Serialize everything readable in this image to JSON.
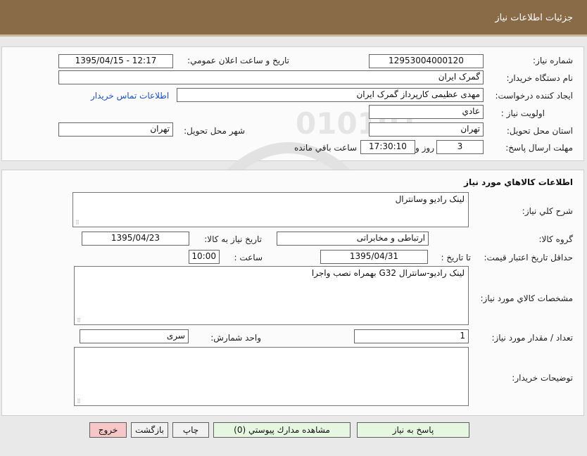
{
  "header": {
    "title": "جزئیات اطلاعات نیاز"
  },
  "general": {
    "need_number_label": "شماره نیاز:",
    "need_number": "12953004000120",
    "announce_label": "تاريخ و ساعت اعلان عمومي:",
    "announce_value": "1395/04/15 - 12:17",
    "buyer_org_label": "نام دستگاه خريدار:",
    "buyer_org": "گمرک ايران",
    "creator_label": "ايجاد كننده درخواست:",
    "creator": "مهدی عظیمی کارپرداز گمرک ایران",
    "contact_link": "اطلاعات تماس خريدار",
    "priority_label": "اولويت نياز :",
    "priority": "عادي",
    "province_label": "استان محل تحويل:",
    "province": "تهران",
    "city_label": "شهر محل تحويل:",
    "city": "تهران",
    "deadline_label": "مهلت ارسال پاسخ:",
    "days": "3",
    "days_label": "روز و",
    "time": "17:30:10",
    "remaining_label": "ساعت باقي مانده"
  },
  "goods": {
    "section_title": "اطلاعات كالاهاي مورد نياز",
    "summary_label": "شرح كلي نياز:",
    "summary": "لینک رادیو وسانترال",
    "group_label": "گروه كالا:",
    "group": "ارتباطی و مخابراتی",
    "need_date_label": "تاريخ نياز به كالا:",
    "need_date": "1395/04/23",
    "validity_label": "حداقل تاريخ اعتبار قيمت:",
    "until_label": "تا تاريخ :",
    "until_date": "1395/04/31",
    "hour_label": "ساعت :",
    "hour": "10:00",
    "spec_label": "مشخصات كالاي مورد نياز:",
    "spec": "لینک رادیو-سانترال G32 بهمراه نصب واجرا",
    "qty_label": "تعداد / مقدار مورد نياز:",
    "qty": "1",
    "unit_label": "واحد شمارش:",
    "unit": "سری",
    "notes_label": "توضيحات خريدار:",
    "notes": ""
  },
  "buttons": {
    "reply": "پاسخ به نياز",
    "attachments": "مشاهده مدارك پيوستي (0)",
    "print": "چاپ",
    "back": "بازگشت",
    "exit": "خروج"
  }
}
